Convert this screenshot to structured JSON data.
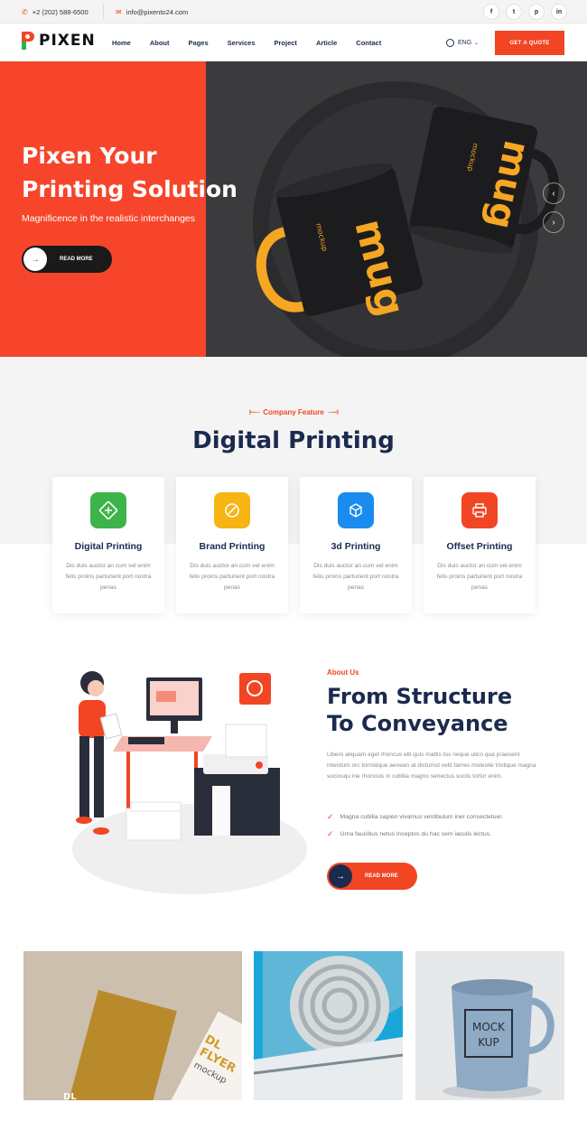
{
  "topbar": {
    "phone": "+2 (202) 588-6500",
    "email": "info@pixento24.com",
    "social": [
      "f",
      "t",
      "p",
      "in"
    ]
  },
  "nav": {
    "logo": "PIXEN",
    "menu": [
      "Home",
      "About",
      "Pages",
      "Services",
      "Project",
      "Article",
      "Contact"
    ],
    "language": "ENG",
    "cta": "GET A QUOTE"
  },
  "hero": {
    "title_line1": "Pixen Your",
    "title_line2": "Printing Solution",
    "subtitle": "Magnificence in the realistic interchanges",
    "button": "READ MORE",
    "mug_word": "mug",
    "mug_sub": "mockup"
  },
  "features": {
    "tag": "Company Feature",
    "title": "Digital Printing",
    "cards": [
      {
        "title": "Digital Printing",
        "text": "Dis duis auctor an cum vel enim felis proins parturient port nostra penas",
        "color": "#3db449",
        "icon": "digital-print-icon"
      },
      {
        "title": "Brand Printing",
        "text": "Dis duis auctor an cum vel enim felis proins parturient port nostra penas",
        "color": "#f6b512",
        "icon": "brand-print-icon"
      },
      {
        "title": "3d Printing",
        "text": "Dis duis auctor an cum vel enim felis proins parturient port nostra penas",
        "color": "#1a8cf0",
        "icon": "3d-print-icon"
      },
      {
        "title": "Offset Printing",
        "text": "Dis duis auctor an cum vel enim felis proins parturient port nostra penas",
        "color": "#f14524",
        "icon": "printer-icon"
      }
    ]
  },
  "about": {
    "tag": "About Us",
    "title_line1": "From Structure",
    "title_line2": "To Conveyance",
    "text": "Libero aliquam eget rhoncus elit quis mattis tos neque ulico qua praesent interdum orc torristique aenean at dictumst velit fames molestie tristique magna sociosqu ine rhoncuis in cubilia magno senectus sociis tortor enim.",
    "checks": [
      "Magna cubilia sapien vivamus vestibulum iner consectetuer.",
      "Urna faucibus netus Inceptos du hac sem iaculis lectus."
    ],
    "button": "READ MORE"
  },
  "gallery": {
    "flyer_line1": "DL",
    "flyer_line2": "FLYER",
    "flyer_line3": "mockup",
    "mock_line1": "MOCK",
    "mock_line2": "KUP"
  },
  "colors": {
    "accent": "#f14524",
    "navy": "#1b2a4e",
    "hero_dark": "#3b3b3d"
  }
}
